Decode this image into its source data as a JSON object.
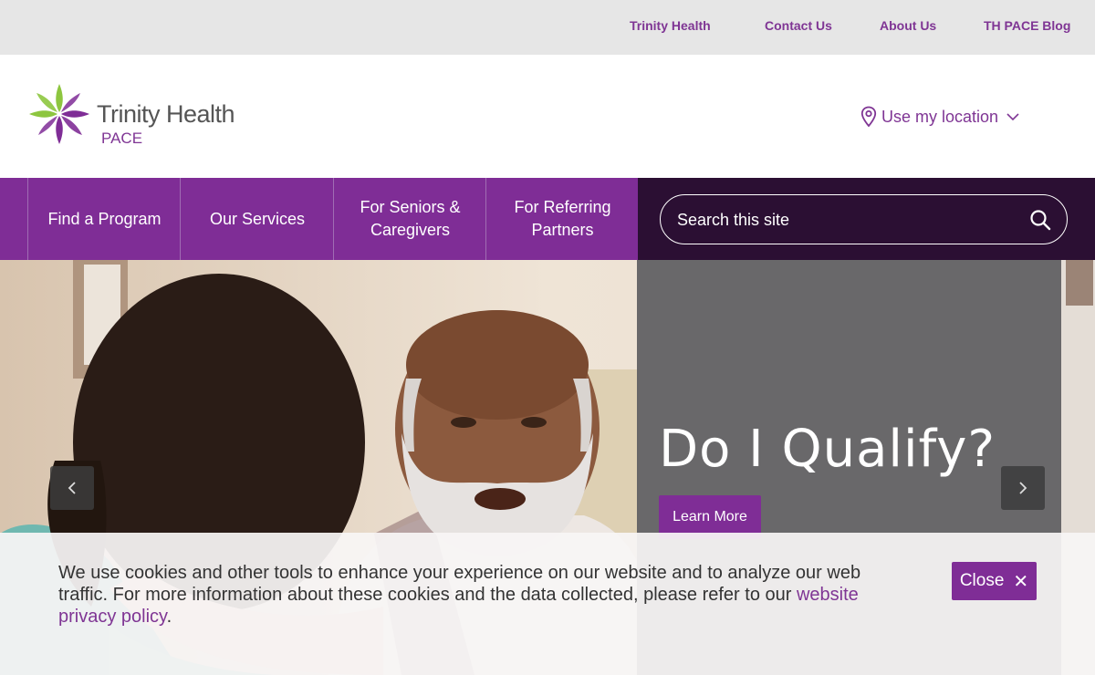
{
  "utility_nav": {
    "items": [
      "Trinity Health",
      "Contact Us",
      "About Us",
      "TH PACE Blog"
    ]
  },
  "logo": {
    "name": "Trinity Health",
    "sub": "PACE"
  },
  "location": {
    "label": "Use my location"
  },
  "nav": {
    "items": [
      "Find a Program",
      "Our Services",
      "For Seniors & Caregivers",
      "For Referring Partners"
    ]
  },
  "search": {
    "placeholder": "Search this site"
  },
  "hero": {
    "title": "Do I Qualify?",
    "cta": "Learn More"
  },
  "cookie": {
    "text": "We use cookies and other tools to enhance your experience on our website and to analyze our web traffic. For more information about these cookies and the data collected, please refer to our ",
    "link": "website privacy policy",
    "suffix": ".",
    "close_label": "Close"
  },
  "colors": {
    "brand_purple": "#7f2d96",
    "search_band": "#2b0f33",
    "utility_bg": "#e6e6e6",
    "hero_panel": "#5f5f62",
    "logo_green": "#8dc63f"
  },
  "icons": [
    "location-pin-icon",
    "chevron-down-icon",
    "search-icon",
    "chevron-left-icon",
    "chevron-right-icon",
    "close-icon"
  ]
}
